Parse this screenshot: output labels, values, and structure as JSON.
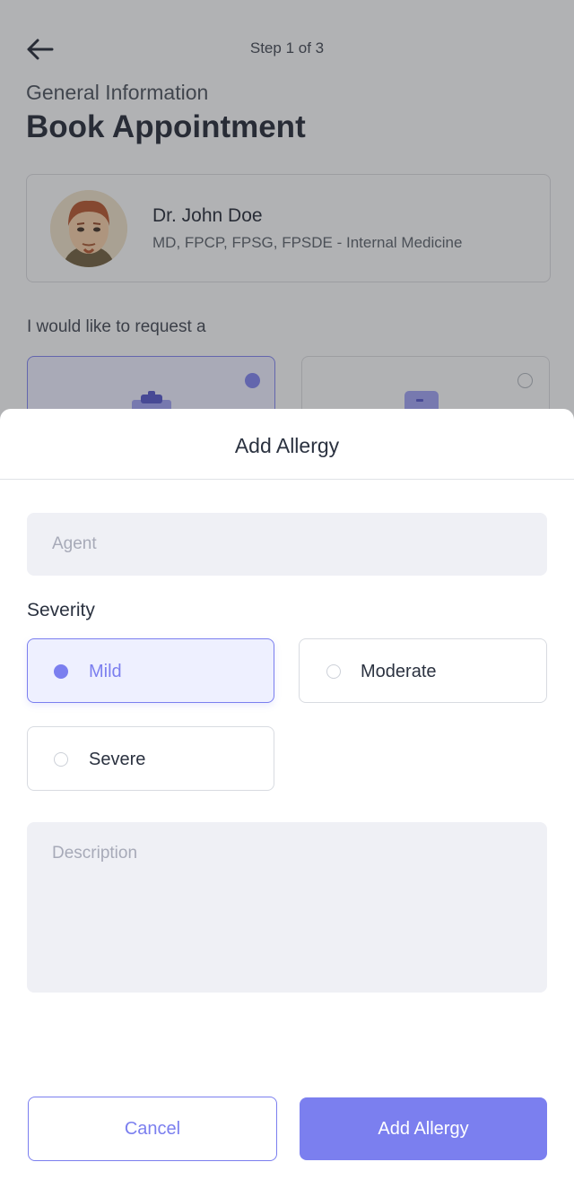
{
  "header": {
    "step_text": "Step 1 of 3",
    "subtitle": "General Information",
    "title": "Book Appointment"
  },
  "doctor": {
    "name": "Dr. John Doe",
    "specialty": "MD, FPCP, FPSG, FPSDE - Internal Medicine"
  },
  "request": {
    "label": "I would like to request a"
  },
  "sheet": {
    "title": "Add Allergy",
    "agent_placeholder": "Agent",
    "severity_label": "Severity",
    "severity_options": [
      {
        "label": "Mild",
        "selected": true
      },
      {
        "label": "Moderate",
        "selected": false
      },
      {
        "label": "Severe",
        "selected": false
      }
    ],
    "description_placeholder": "Description",
    "cancel_label": "Cancel",
    "submit_label": "Add Allergy"
  },
  "colors": {
    "accent": "#7b7fef",
    "input_bg": "#eff0f5",
    "text_dark": "#2b3240"
  },
  "icons": {
    "back": "arrow-left-icon",
    "radio_selected": "radio-selected-icon",
    "radio_unselected": "radio-unselected-icon"
  }
}
